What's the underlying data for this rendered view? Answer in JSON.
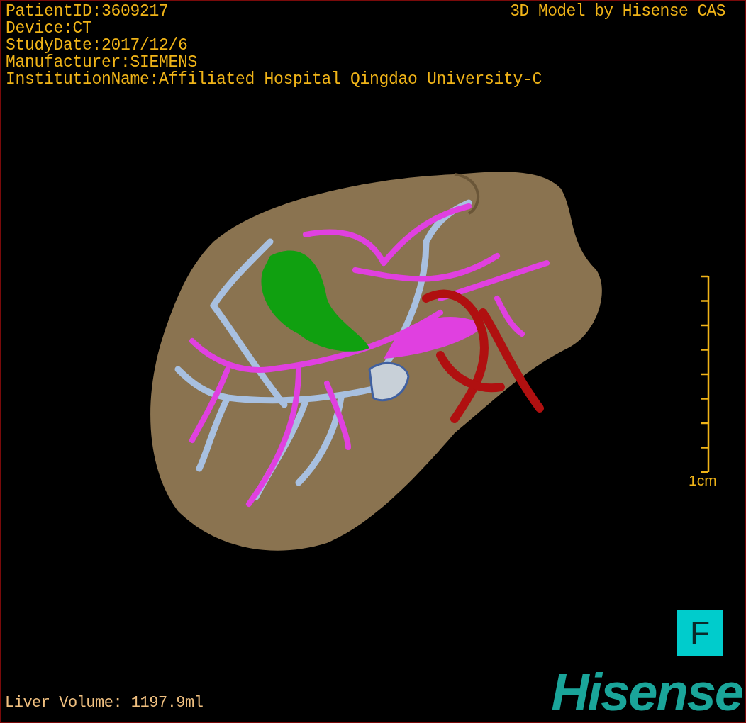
{
  "info_lines": [
    "PatientID:3609217",
    "Device:CT",
    "StudyDate:2017/12/6",
    "Manufacturer:SIEMENS",
    "InstitutionName:Affiliated Hospital Qingdao University-C"
  ],
  "model_credit": "3D Model by Hisense CAS",
  "scale_bar": {
    "label": "1cm"
  },
  "orientation": {
    "label": "F"
  },
  "liver_volume": "Liver Volume: 1197.9ml",
  "logo": "Hisense"
}
